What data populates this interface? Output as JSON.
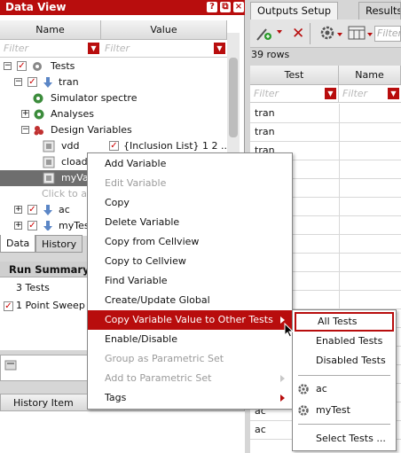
{
  "data_view": {
    "title": "Data View",
    "title_buttons": [
      "?",
      "⧉",
      "×"
    ],
    "col_name": "Name",
    "col_value": "Value",
    "filter_placeholder": "Filter",
    "tree": [
      {
        "label": "Tests",
        "value": ""
      },
      {
        "label": "tran",
        "value": ""
      },
      {
        "label": "Simulator  spectre",
        "value": ""
      },
      {
        "label": "Analyses",
        "value": ""
      },
      {
        "label": "Design Variables",
        "value": ""
      },
      {
        "label": "vdd",
        "value": "{Inclusion List} 1 2 ..."
      },
      {
        "label": "cload",
        "value": ""
      },
      {
        "label": "myVa",
        "value": ""
      },
      {
        "label": "Click to ad",
        "value": ""
      },
      {
        "label": "ac",
        "value": ""
      },
      {
        "label": "myTes",
        "value": ""
      }
    ],
    "tabs": [
      "Data",
      "History"
    ]
  },
  "run_summary": {
    "title": "Run Summary",
    "tests": "3 Tests",
    "sweep": "1 Point Sweep"
  },
  "history": {
    "header": "History Item"
  },
  "outputs": {
    "tabs": [
      "Outputs Setup",
      "Results"
    ],
    "filter_placeholder": "Filter",
    "rows_count": "39 rows",
    "col_test": "Test",
    "col_name": "Name",
    "rows": [
      "tran",
      "tran",
      "tran",
      "",
      "",
      "",
      "",
      "",
      "",
      "",
      "",
      "",
      "",
      "",
      "",
      "",
      "ac",
      "ac"
    ]
  },
  "context_menu": {
    "items": [
      {
        "label": "Add Variable",
        "disabled": false,
        "submenu": false
      },
      {
        "label": "Edit Variable",
        "disabled": true,
        "submenu": false
      },
      {
        "label": "Copy",
        "disabled": false,
        "submenu": false
      },
      {
        "label": "Delete Variable",
        "disabled": false,
        "submenu": false
      },
      {
        "label": "Copy from Cellview",
        "disabled": false,
        "submenu": false
      },
      {
        "label": "Copy to Cellview",
        "disabled": false,
        "submenu": false
      },
      {
        "label": "Find Variable",
        "disabled": false,
        "submenu": false
      },
      {
        "label": "Create/Update Global",
        "disabled": false,
        "submenu": false
      },
      {
        "label": "Copy Variable Value to Other Tests",
        "disabled": false,
        "submenu": true,
        "highlighted": true
      },
      {
        "label": "Enable/Disable",
        "disabled": false,
        "submenu": false
      },
      {
        "label": "Group as Parametric Set",
        "disabled": true,
        "submenu": false
      },
      {
        "label": "Add to Parametric Set",
        "disabled": true,
        "submenu": true
      },
      {
        "label": "Tags",
        "disabled": false,
        "submenu": true
      }
    ]
  },
  "submenu": {
    "all_tests": "All Tests",
    "enabled_tests": "Enabled Tests",
    "disabled_tests": "Disabled Tests",
    "test_ac": "ac",
    "test_mytest": "myTest",
    "select_tests": "Select Tests ..."
  },
  "colors": {
    "accent": "#b80d0d",
    "panel": "#d6d6d6"
  },
  "icons": [
    "expand-icon",
    "checkbox-icon",
    "gear-icon",
    "test-arrow-icon",
    "variable-icon",
    "filter-icon",
    "submenu-arrow-icon"
  ]
}
